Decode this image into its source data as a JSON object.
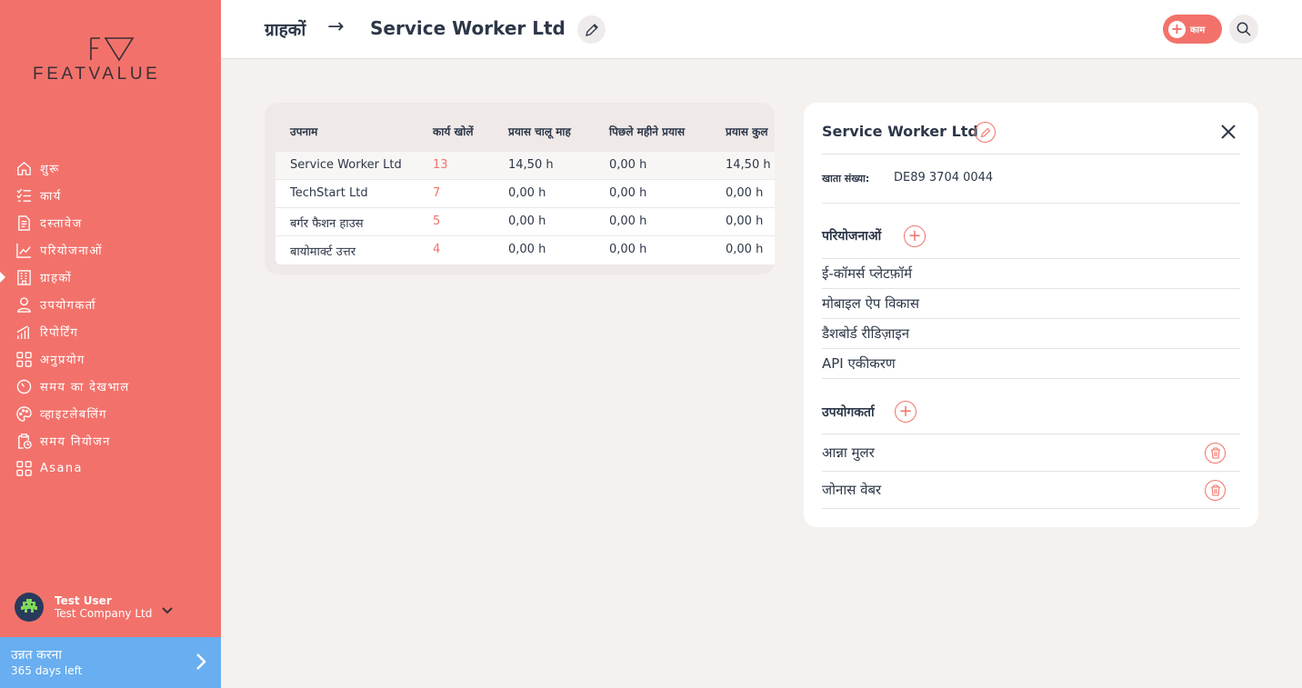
{
  "brand": {
    "logo_text": "FEATVALUE",
    "accent": "#f2726b",
    "upgrade_color": "#68aef0"
  },
  "sidebar": {
    "items": [
      {
        "label": "शुरू",
        "icon": "home-icon"
      },
      {
        "label": "कार्य",
        "icon": "task-list-icon"
      },
      {
        "label": "दस्तावेज",
        "icon": "document-icon"
      },
      {
        "label": "परियोजनाओं",
        "icon": "project-chart-icon"
      },
      {
        "label": "ग्राहकों",
        "icon": "building-icon"
      },
      {
        "label": "उपयोगकर्ता",
        "icon": "user-icon"
      },
      {
        "label": "रिपोर्टिंग",
        "icon": "reporting-icon"
      },
      {
        "label": "अनुप्रयोग",
        "icon": "apps-icon"
      },
      {
        "label": "समय का देखभाल",
        "icon": "timer-icon"
      },
      {
        "label": "व्हाइटलेबलिंग",
        "icon": "palette-icon"
      },
      {
        "label": "समय नियोजन",
        "icon": "clipboard-clock-icon"
      },
      {
        "label": "Asana",
        "icon": "apps-icon"
      }
    ],
    "user": {
      "name": "Test User",
      "company": "Test Company Ltd"
    },
    "upgrade": {
      "title": "उन्नत करना",
      "subtitle": "365 days left"
    }
  },
  "header": {
    "breadcrumb_root": "ग्राहकों",
    "breadcrumb_arrow": "→",
    "breadcrumb_current": "Service Worker Ltd",
    "task_button_label": "काम"
  },
  "table": {
    "columns": [
      "उपनाम",
      "कार्य खोलें",
      "प्रयास चालू माह",
      "पिछले महीने प्रयास",
      "प्रयास कुल"
    ],
    "rows": [
      {
        "name": "Service Worker Ltd",
        "open": "13",
        "current": "14,50 h",
        "last": "0,00 h",
        "total": "14,50 h"
      },
      {
        "name": "TechStart Ltd",
        "open": "7",
        "current": "0,00 h",
        "last": "0,00 h",
        "total": "0,00 h"
      },
      {
        "name": "बर्गर फैशन हाउस",
        "open": "5",
        "current": "0,00 h",
        "last": "0,00 h",
        "total": "0,00 h"
      },
      {
        "name": "बायोमार्क्ट उत्तर",
        "open": "4",
        "current": "0,00 h",
        "last": "0,00 h",
        "total": "0,00 h"
      }
    ]
  },
  "panel": {
    "title": "Service Worker Ltd",
    "account_label": "खाता संख्या:",
    "account_value": "DE89 3704 0044",
    "projects_title": "परियोजनाओं",
    "projects": [
      "ई-कॉमर्स प्लेटफ़ॉर्म",
      "मोबाइल ऐप विकास",
      "डैशबोर्ड रीडिज़ाइन",
      "API एकीकरण"
    ],
    "users_title": "उपयोगकर्ता",
    "users": [
      "आन्ना मुलर",
      "जोनास वेबर"
    ]
  }
}
